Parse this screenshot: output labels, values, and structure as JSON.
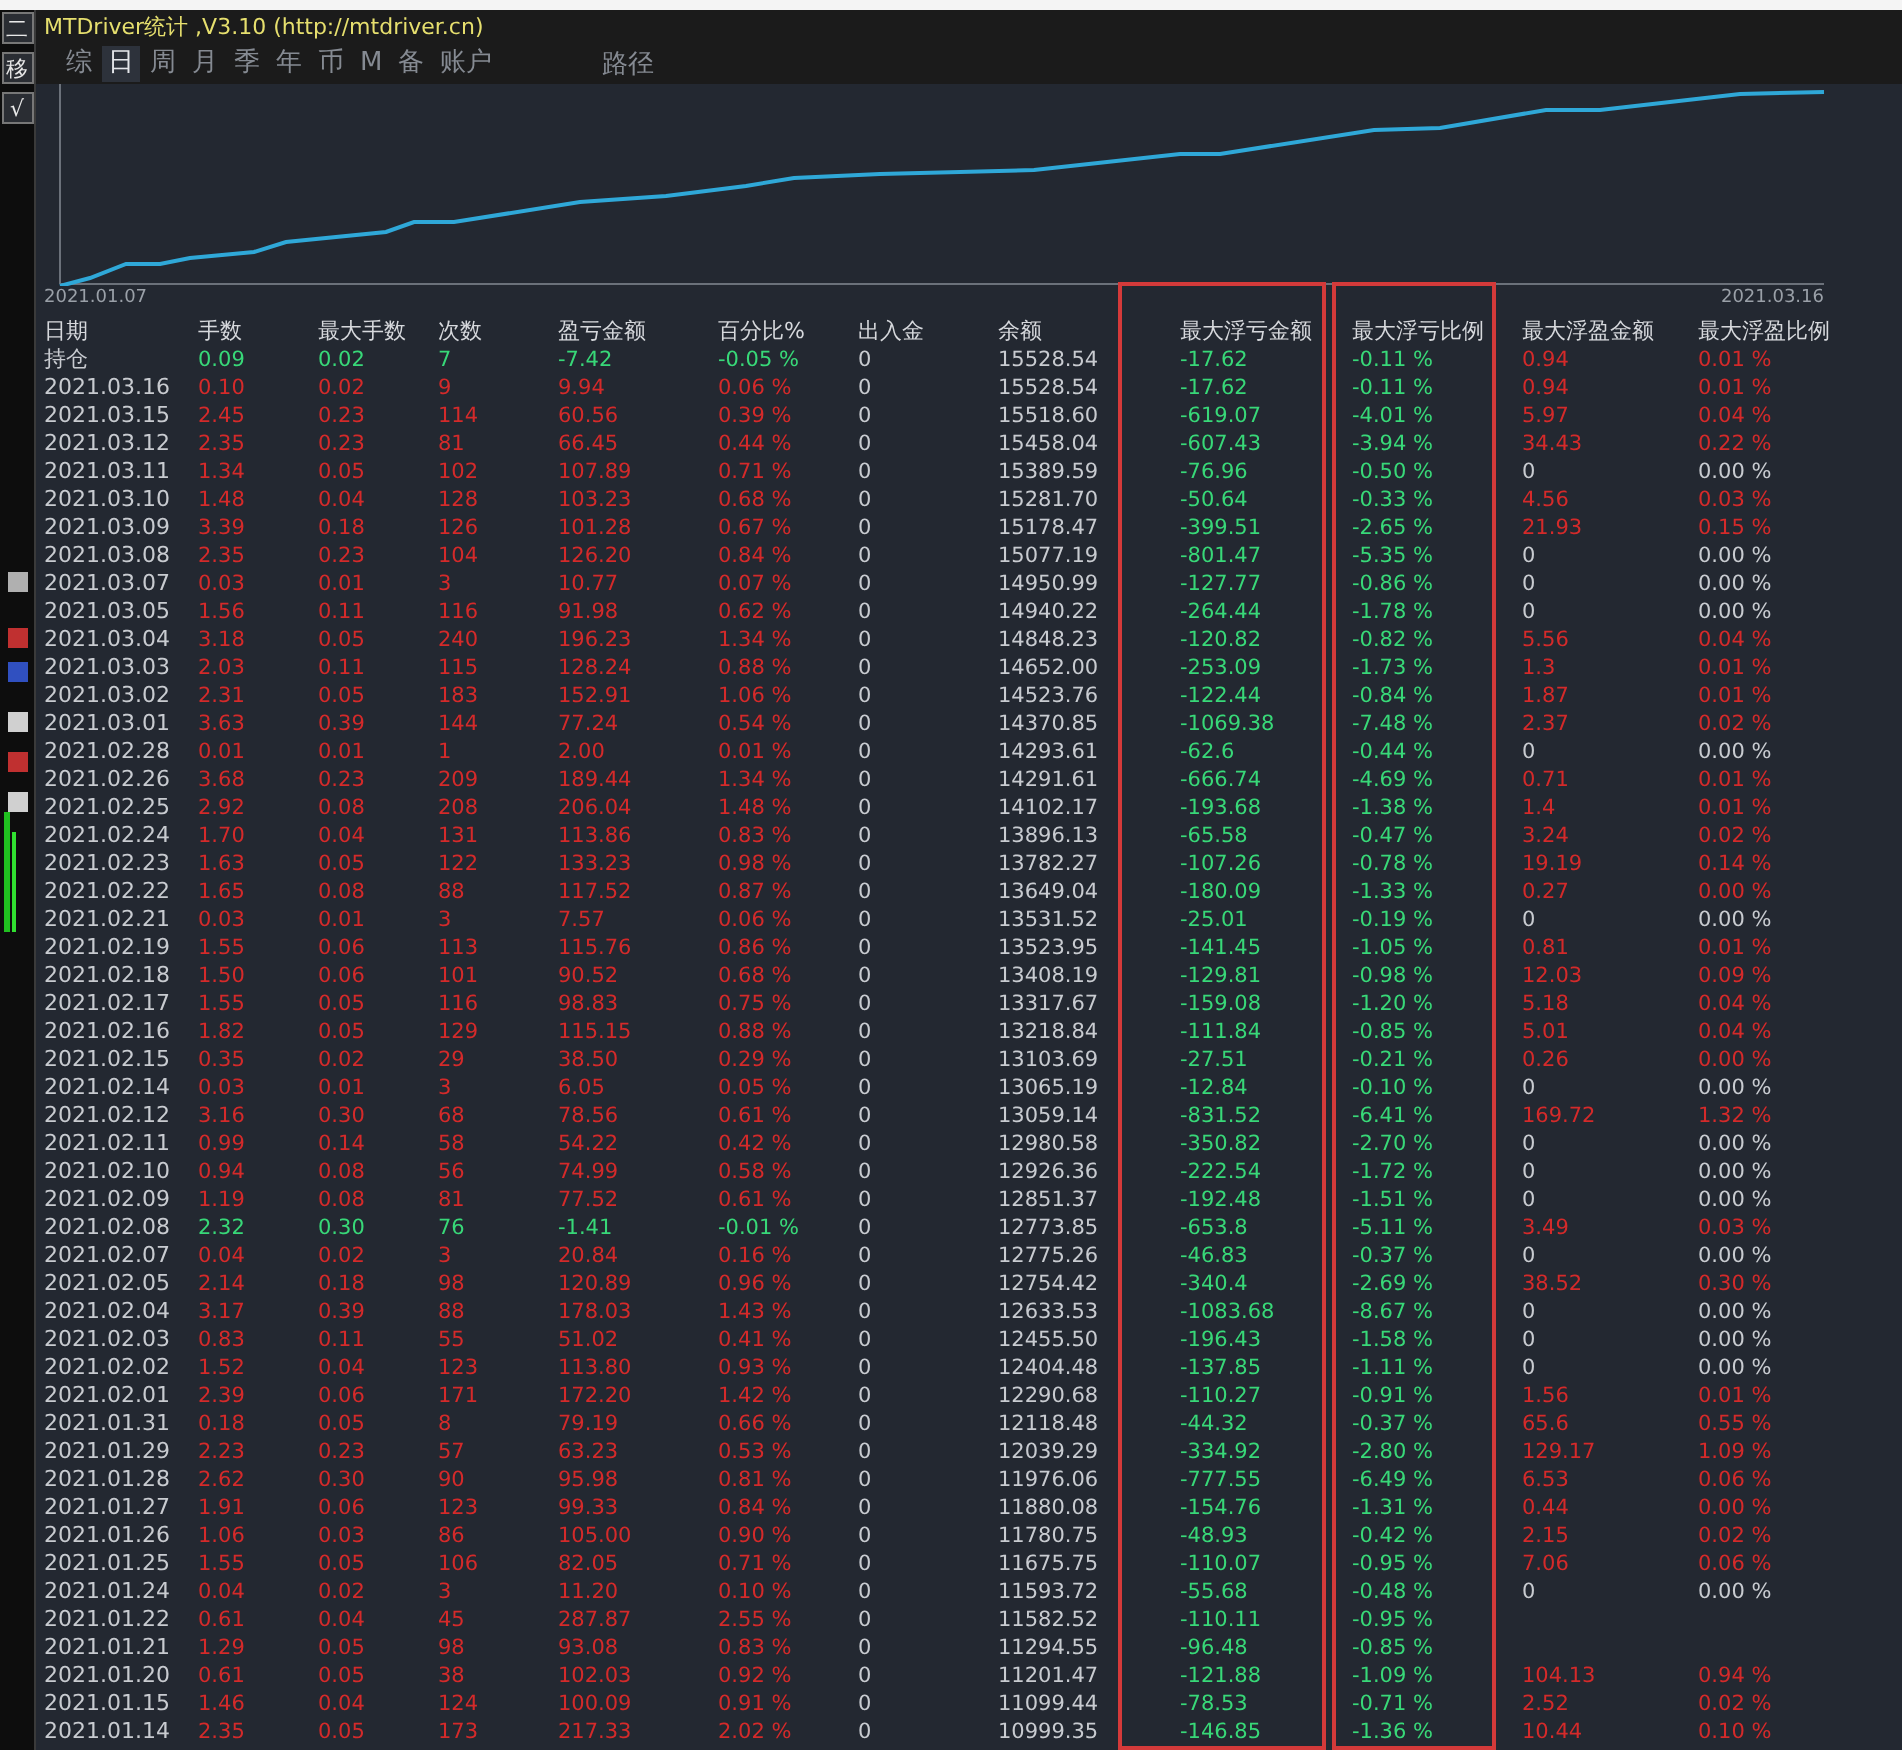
{
  "window": {
    "title": "MTDriver统计 ,V3.10 (http://mtdriver.cn)"
  },
  "side_buttons": [
    "二",
    "移",
    "√"
  ],
  "tabs": [
    {
      "label": "综",
      "selected": false
    },
    {
      "label": "日",
      "selected": true
    },
    {
      "label": "周",
      "selected": false
    },
    {
      "label": "月",
      "selected": false
    },
    {
      "label": "季",
      "selected": false
    },
    {
      "label": "年",
      "selected": false
    },
    {
      "label": "币",
      "selected": false
    },
    {
      "label": "M",
      "selected": false
    },
    {
      "label": "备",
      "selected": false
    },
    {
      "label": "账户",
      "selected": false
    }
  ],
  "path_label": "路径",
  "chart": {
    "start_label": "2021.01.07",
    "end_label": "2021.03.16"
  },
  "table": {
    "date_label": "日期",
    "columns": [
      {
        "label": "手数",
        "kind": "trade",
        "highlighted": false
      },
      {
        "label": "最大手数",
        "kind": "trade",
        "highlighted": false
      },
      {
        "label": "次数",
        "kind": "trade",
        "highlighted": false
      },
      {
        "label": "盈亏金额",
        "kind": "trade",
        "highlighted": false
      },
      {
        "label": "百分比%",
        "kind": "trade",
        "highlighted": false
      },
      {
        "label": "出入金",
        "kind": "neutral",
        "highlighted": false
      },
      {
        "label": "余额",
        "kind": "neutral",
        "highlighted": false
      },
      {
        "label": "最大浮亏金额",
        "kind": "drawdown",
        "highlighted": true
      },
      {
        "label": "最大浮亏比例",
        "kind": "drawdown",
        "highlighted": true
      },
      {
        "label": "最大浮盈金额",
        "kind": "gain",
        "highlighted": false
      },
      {
        "label": "最大浮盈比例",
        "kind": "gain",
        "highlighted": false
      }
    ],
    "rows": [
      {
        "date": "持仓",
        "loss": true,
        "float_gain": true,
        "cells": [
          "0.09",
          "0.02",
          "7",
          "-7.42",
          "-0.05 %",
          "0",
          "15528.54",
          "-17.62",
          "-0.11 %",
          "0.94",
          "0.01 %"
        ]
      },
      {
        "date": "2021.03.16",
        "loss": false,
        "float_gain": true,
        "cells": [
          "0.10",
          "0.02",
          "9",
          "9.94",
          "0.06 %",
          "0",
          "15528.54",
          "-17.62",
          "-0.11 %",
          "0.94",
          "0.01 %"
        ]
      },
      {
        "date": "2021.03.15",
        "loss": false,
        "float_gain": true,
        "cells": [
          "2.45",
          "0.23",
          "114",
          "60.56",
          "0.39 %",
          "0",
          "15518.60",
          "-619.07",
          "-4.01 %",
          "5.97",
          "0.04 %"
        ]
      },
      {
        "date": "2021.03.12",
        "loss": false,
        "float_gain": true,
        "cells": [
          "2.35",
          "0.23",
          "81",
          "66.45",
          "0.44 %",
          "0",
          "15458.04",
          "-607.43",
          "-3.94 %",
          "34.43",
          "0.22 %"
        ]
      },
      {
        "date": "2021.03.11",
        "loss": false,
        "float_gain": false,
        "cells": [
          "1.34",
          "0.05",
          "102",
          "107.89",
          "0.71 %",
          "0",
          "15389.59",
          "-76.96",
          "-0.50 %",
          "0",
          "0.00 %"
        ]
      },
      {
        "date": "2021.03.10",
        "loss": false,
        "float_gain": true,
        "cells": [
          "1.48",
          "0.04",
          "128",
          "103.23",
          "0.68 %",
          "0",
          "15281.70",
          "-50.64",
          "-0.33 %",
          "4.56",
          "0.03 %"
        ]
      },
      {
        "date": "2021.03.09",
        "loss": false,
        "float_gain": true,
        "cells": [
          "3.39",
          "0.18",
          "126",
          "101.28",
          "0.67 %",
          "0",
          "15178.47",
          "-399.51",
          "-2.65 %",
          "21.93",
          "0.15 %"
        ]
      },
      {
        "date": "2021.03.08",
        "loss": false,
        "float_gain": false,
        "cells": [
          "2.35",
          "0.23",
          "104",
          "126.20",
          "0.84 %",
          "0",
          "15077.19",
          "-801.47",
          "-5.35 %",
          "0",
          "0.00 %"
        ]
      },
      {
        "date": "2021.03.07",
        "loss": false,
        "float_gain": false,
        "cells": [
          "0.03",
          "0.01",
          "3",
          "10.77",
          "0.07 %",
          "0",
          "14950.99",
          "-127.77",
          "-0.86 %",
          "0",
          "0.00 %"
        ]
      },
      {
        "date": "2021.03.05",
        "loss": false,
        "float_gain": false,
        "cells": [
          "1.56",
          "0.11",
          "116",
          "91.98",
          "0.62 %",
          "0",
          "14940.22",
          "-264.44",
          "-1.78 %",
          "0",
          "0.00 %"
        ]
      },
      {
        "date": "2021.03.04",
        "loss": false,
        "float_gain": true,
        "cells": [
          "3.18",
          "0.05",
          "240",
          "196.23",
          "1.34 %",
          "0",
          "14848.23",
          "-120.82",
          "-0.82 %",
          "5.56",
          "0.04 %"
        ]
      },
      {
        "date": "2021.03.03",
        "loss": false,
        "float_gain": true,
        "cells": [
          "2.03",
          "0.11",
          "115",
          "128.24",
          "0.88 %",
          "0",
          "14652.00",
          "-253.09",
          "-1.73 %",
          "1.3",
          "0.01 %"
        ]
      },
      {
        "date": "2021.03.02",
        "loss": false,
        "float_gain": true,
        "cells": [
          "2.31",
          "0.05",
          "183",
          "152.91",
          "1.06 %",
          "0",
          "14523.76",
          "-122.44",
          "-0.84 %",
          "1.87",
          "0.01 %"
        ]
      },
      {
        "date": "2021.03.01",
        "loss": false,
        "float_gain": true,
        "cells": [
          "3.63",
          "0.39",
          "144",
          "77.24",
          "0.54 %",
          "0",
          "14370.85",
          "-1069.38",
          "-7.48 %",
          "2.37",
          "0.02 %"
        ]
      },
      {
        "date": "2021.02.28",
        "loss": false,
        "float_gain": false,
        "cells": [
          "0.01",
          "0.01",
          "1",
          "2.00",
          "0.01 %",
          "0",
          "14293.61",
          "-62.6",
          "-0.44 %",
          "0",
          "0.00 %"
        ]
      },
      {
        "date": "2021.02.26",
        "loss": false,
        "float_gain": true,
        "cells": [
          "3.68",
          "0.23",
          "209",
          "189.44",
          "1.34 %",
          "0",
          "14291.61",
          "-666.74",
          "-4.69 %",
          "0.71",
          "0.01 %"
        ]
      },
      {
        "date": "2021.02.25",
        "loss": false,
        "float_gain": true,
        "cells": [
          "2.92",
          "0.08",
          "208",
          "206.04",
          "1.48 %",
          "0",
          "14102.17",
          "-193.68",
          "-1.38 %",
          "1.4",
          "0.01 %"
        ]
      },
      {
        "date": "2021.02.24",
        "loss": false,
        "float_gain": true,
        "cells": [
          "1.70",
          "0.04",
          "131",
          "113.86",
          "0.83 %",
          "0",
          "13896.13",
          "-65.58",
          "-0.47 %",
          "3.24",
          "0.02 %"
        ]
      },
      {
        "date": "2021.02.23",
        "loss": false,
        "float_gain": true,
        "cells": [
          "1.63",
          "0.05",
          "122",
          "133.23",
          "0.98 %",
          "0",
          "13782.27",
          "-107.26",
          "-0.78 %",
          "19.19",
          "0.14 %"
        ]
      },
      {
        "date": "2021.02.22",
        "loss": false,
        "float_gain": true,
        "cells": [
          "1.65",
          "0.08",
          "88",
          "117.52",
          "0.87 %",
          "0",
          "13649.04",
          "-180.09",
          "-1.33 %",
          "0.27",
          "0.00 %"
        ]
      },
      {
        "date": "2021.02.21",
        "loss": false,
        "float_gain": false,
        "cells": [
          "0.03",
          "0.01",
          "3",
          "7.57",
          "0.06 %",
          "0",
          "13531.52",
          "-25.01",
          "-0.19 %",
          "0",
          "0.00 %"
        ]
      },
      {
        "date": "2021.02.19",
        "loss": false,
        "float_gain": true,
        "cells": [
          "1.55",
          "0.06",
          "113",
          "115.76",
          "0.86 %",
          "0",
          "13523.95",
          "-141.45",
          "-1.05 %",
          "0.81",
          "0.01 %"
        ]
      },
      {
        "date": "2021.02.18",
        "loss": false,
        "float_gain": true,
        "cells": [
          "1.50",
          "0.06",
          "101",
          "90.52",
          "0.68 %",
          "0",
          "13408.19",
          "-129.81",
          "-0.98 %",
          "12.03",
          "0.09 %"
        ]
      },
      {
        "date": "2021.02.17",
        "loss": false,
        "float_gain": true,
        "cells": [
          "1.55",
          "0.05",
          "116",
          "98.83",
          "0.75 %",
          "0",
          "13317.67",
          "-159.08",
          "-1.20 %",
          "5.18",
          "0.04 %"
        ]
      },
      {
        "date": "2021.02.16",
        "loss": false,
        "float_gain": true,
        "cells": [
          "1.82",
          "0.05",
          "129",
          "115.15",
          "0.88 %",
          "0",
          "13218.84",
          "-111.84",
          "-0.85 %",
          "5.01",
          "0.04 %"
        ]
      },
      {
        "date": "2021.02.15",
        "loss": false,
        "float_gain": true,
        "cells": [
          "0.35",
          "0.02",
          "29",
          "38.50",
          "0.29 %",
          "0",
          "13103.69",
          "-27.51",
          "-0.21 %",
          "0.26",
          "0.00 %"
        ]
      },
      {
        "date": "2021.02.14",
        "loss": false,
        "float_gain": false,
        "cells": [
          "0.03",
          "0.01",
          "3",
          "6.05",
          "0.05 %",
          "0",
          "13065.19",
          "-12.84",
          "-0.10 %",
          "0",
          "0.00 %"
        ]
      },
      {
        "date": "2021.02.12",
        "loss": false,
        "float_gain": true,
        "cells": [
          "3.16",
          "0.30",
          "68",
          "78.56",
          "0.61 %",
          "0",
          "13059.14",
          "-831.52",
          "-6.41 %",
          "169.72",
          "1.32 %"
        ]
      },
      {
        "date": "2021.02.11",
        "loss": false,
        "float_gain": false,
        "cells": [
          "0.99",
          "0.14",
          "58",
          "54.22",
          "0.42 %",
          "0",
          "12980.58",
          "-350.82",
          "-2.70 %",
          "0",
          "0.00 %"
        ]
      },
      {
        "date": "2021.02.10",
        "loss": false,
        "float_gain": false,
        "cells": [
          "0.94",
          "0.08",
          "56",
          "74.99",
          "0.58 %",
          "0",
          "12926.36",
          "-222.54",
          "-1.72 %",
          "0",
          "0.00 %"
        ]
      },
      {
        "date": "2021.02.09",
        "loss": false,
        "float_gain": false,
        "cells": [
          "1.19",
          "0.08",
          "81",
          "77.52",
          "0.61 %",
          "0",
          "12851.37",
          "-192.48",
          "-1.51 %",
          "0",
          "0.00 %"
        ]
      },
      {
        "date": "2021.02.08",
        "loss": true,
        "float_gain": true,
        "cells": [
          "2.32",
          "0.30",
          "76",
          "-1.41",
          "-0.01 %",
          "0",
          "12773.85",
          "-653.8",
          "-5.11 %",
          "3.49",
          "0.03 %"
        ]
      },
      {
        "date": "2021.02.07",
        "loss": false,
        "float_gain": false,
        "cells": [
          "0.04",
          "0.02",
          "3",
          "20.84",
          "0.16 %",
          "0",
          "12775.26",
          "-46.83",
          "-0.37 %",
          "0",
          "0.00 %"
        ]
      },
      {
        "date": "2021.02.05",
        "loss": false,
        "float_gain": true,
        "cells": [
          "2.14",
          "0.18",
          "98",
          "120.89",
          "0.96 %",
          "0",
          "12754.42",
          "-340.4",
          "-2.69 %",
          "38.52",
          "0.30 %"
        ]
      },
      {
        "date": "2021.02.04",
        "loss": false,
        "float_gain": false,
        "cells": [
          "3.17",
          "0.39",
          "88",
          "178.03",
          "1.43 %",
          "0",
          "12633.53",
          "-1083.68",
          "-8.67 %",
          "0",
          "0.00 %"
        ]
      },
      {
        "date": "2021.02.03",
        "loss": false,
        "float_gain": false,
        "cells": [
          "0.83",
          "0.11",
          "55",
          "51.02",
          "0.41 %",
          "0",
          "12455.50",
          "-196.43",
          "-1.58 %",
          "0",
          "0.00 %"
        ]
      },
      {
        "date": "2021.02.02",
        "loss": false,
        "float_gain": false,
        "cells": [
          "1.52",
          "0.04",
          "123",
          "113.80",
          "0.93 %",
          "0",
          "12404.48",
          "-137.85",
          "-1.11 %",
          "0",
          "0.00 %"
        ]
      },
      {
        "date": "2021.02.01",
        "loss": false,
        "float_gain": true,
        "cells": [
          "2.39",
          "0.06",
          "171",
          "172.20",
          "1.42 %",
          "0",
          "12290.68",
          "-110.27",
          "-0.91 %",
          "1.56",
          "0.01 %"
        ]
      },
      {
        "date": "2021.01.31",
        "loss": false,
        "float_gain": true,
        "cells": [
          "0.18",
          "0.05",
          "8",
          "79.19",
          "0.66 %",
          "0",
          "12118.48",
          "-44.32",
          "-0.37 %",
          "65.6",
          "0.55 %"
        ]
      },
      {
        "date": "2021.01.29",
        "loss": false,
        "float_gain": true,
        "cells": [
          "2.23",
          "0.23",
          "57",
          "63.23",
          "0.53 %",
          "0",
          "12039.29",
          "-334.92",
          "-2.80 %",
          "129.17",
          "1.09 %"
        ]
      },
      {
        "date": "2021.01.28",
        "loss": false,
        "float_gain": true,
        "cells": [
          "2.62",
          "0.30",
          "90",
          "95.98",
          "0.81 %",
          "0",
          "11976.06",
          "-777.55",
          "-6.49 %",
          "6.53",
          "0.06 %"
        ]
      },
      {
        "date": "2021.01.27",
        "loss": false,
        "float_gain": true,
        "cells": [
          "1.91",
          "0.06",
          "123",
          "99.33",
          "0.84 %",
          "0",
          "11880.08",
          "-154.76",
          "-1.31 %",
          "0.44",
          "0.00 %"
        ]
      },
      {
        "date": "2021.01.26",
        "loss": false,
        "float_gain": true,
        "cells": [
          "1.06",
          "0.03",
          "86",
          "105.00",
          "0.90 %",
          "0",
          "11780.75",
          "-48.93",
          "-0.42 %",
          "2.15",
          "0.02 %"
        ]
      },
      {
        "date": "2021.01.25",
        "loss": false,
        "float_gain": true,
        "cells": [
          "1.55",
          "0.05",
          "106",
          "82.05",
          "0.71 %",
          "0",
          "11675.75",
          "-110.07",
          "-0.95 %",
          "7.06",
          "0.06 %"
        ]
      },
      {
        "date": "2021.01.24",
        "loss": false,
        "float_gain": false,
        "cells": [
          "0.04",
          "0.02",
          "3",
          "11.20",
          "0.10 %",
          "0",
          "11593.72",
          "-55.68",
          "-0.48 %",
          "0",
          "0.00 %"
        ]
      },
      {
        "date": "2021.01.22",
        "loss": false,
        "cells": [
          "0.61",
          "0.04",
          "45",
          "287.87",
          "2.55 %",
          "0",
          "11582.52",
          "-110.11",
          "-0.95 %"
        ]
      },
      {
        "date": "2021.01.21",
        "loss": false,
        "cells": [
          "1.29",
          "0.05",
          "98",
          "93.08",
          "0.83 %",
          "0",
          "11294.55",
          "-96.48",
          "-0.85 %"
        ]
      },
      {
        "date": "2021.01.20",
        "loss": false,
        "float_gain": true,
        "cells": [
          "0.61",
          "0.05",
          "38",
          "102.03",
          "0.92 %",
          "0",
          "11201.47",
          "-121.88",
          "-1.09 %",
          "104.13",
          "0.94 %"
        ]
      },
      {
        "date": "2021.01.15",
        "loss": false,
        "float_gain": true,
        "cells": [
          "1.46",
          "0.04",
          "124",
          "100.09",
          "0.91 %",
          "0",
          "11099.44",
          "-78.53",
          "-0.71 %",
          "2.52",
          "0.02 %"
        ]
      },
      {
        "date": "2021.01.14",
        "loss": false,
        "float_gain": true,
        "cells": [
          "2.35",
          "0.05",
          "173",
          "217.33",
          "2.02 %",
          "0",
          "10999.35",
          "-146.85",
          "-1.36 %",
          "10.44",
          "0.10 %"
        ]
      }
    ]
  }
}
